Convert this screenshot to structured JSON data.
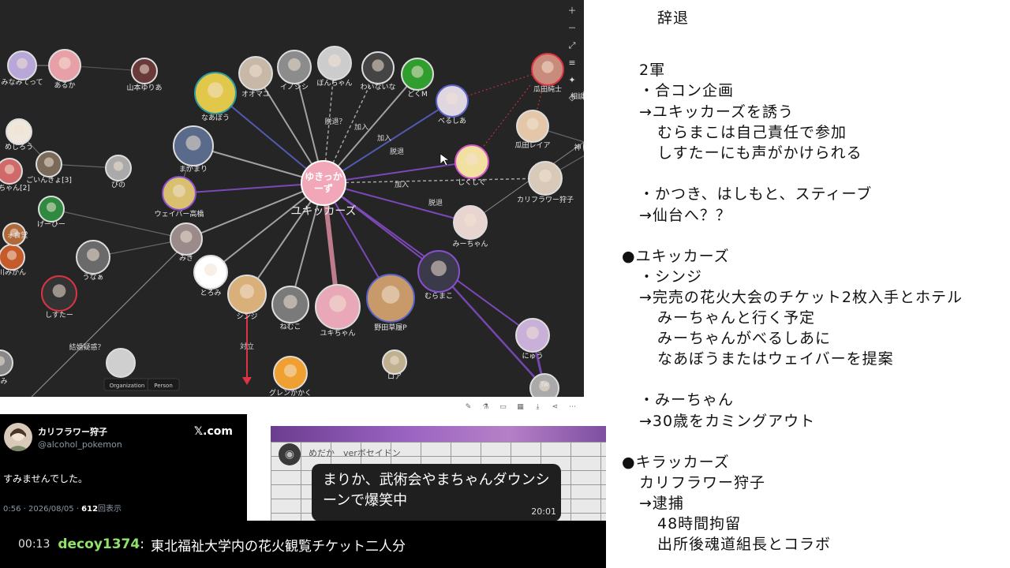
{
  "graph": {
    "hub": {
      "inner": "ゆきっか\nーず",
      "label": "ユキッカーズ"
    },
    "nodes": [
      {
        "label": "みなみてって",
        "color": "#b9a7d9",
        "ring": "#dddddd"
      },
      {
        "label": "あるか",
        "color": "#e8a0a8",
        "ring": "#dddddd"
      },
      {
        "label": "山本ゆりあ",
        "color": "#6a3a3a",
        "ring": "#dddddd"
      },
      {
        "label": "オオマユ",
        "color": "#c8b8a8",
        "ring": "#dddddd"
      },
      {
        "label": "イノシシ",
        "color": "#8c8c8c",
        "ring": "#dddddd"
      },
      {
        "label": "ぼんちゃん",
        "color": "#cccccc",
        "ring": "#dddddd"
      },
      {
        "label": "わいないな",
        "color": "#444444",
        "ring": "#dddddd"
      },
      {
        "label": "どくM",
        "color": "#2f9e2f",
        "ring": "#dddddd"
      },
      {
        "label": "なあぼう",
        "color": "#e2c84a",
        "ring": "#2f9aa0"
      },
      {
        "label": "べるしあ",
        "color": "#e0d6e0",
        "ring": "#5a63c9"
      },
      {
        "label": "瓜田純士",
        "color": "#c98c7c",
        "ring": "#dd3344"
      },
      {
        "label": "瓜田レイア",
        "color": "#e3c7a8",
        "ring": "#dddddd"
      },
      {
        "label": "めじろう",
        "color": "#efe6dc",
        "ring": "#dddddd"
      },
      {
        "label": "ごいんきょ[3]",
        "color": "#7a6a5a",
        "ring": "#dddddd"
      },
      {
        "label": "ぴの",
        "color": "#aaaaaa",
        "ring": "#dddddd"
      },
      {
        "label": "まがまり",
        "color": "#5a6a8a",
        "ring": "#dddddd"
      },
      {
        "label": "しくしぐ",
        "color": "#f2e0a0",
        "ring": "#d356c9"
      },
      {
        "label": "カリフラワー狩子",
        "color": "#d9c9b8",
        "ring": "#dddddd"
      },
      {
        "label": "げーひー",
        "color": "#2f8a3f",
        "ring": "#dddddd"
      },
      {
        "label": "ウェイバー高橋",
        "color": "#d8c070",
        "ring": "#8a4fd1"
      },
      {
        "label": "みーちゃん",
        "color": "#e9d5cf",
        "ring": "#dddddd"
      },
      {
        "label": "みき",
        "color": "#9a8a8a",
        "ring": "#dddddd"
      },
      {
        "label": "うなぁ",
        "color": "#6a6a6a",
        "ring": "#dddddd"
      },
      {
        "label": "むらまこ",
        "color": "#3a3a4a",
        "ring": "#8a4fd1"
      },
      {
        "label": "川みかん",
        "color": "#c55a2a",
        "ring": "#dddddd"
      },
      {
        "label": "しすたー",
        "color": "#333333",
        "ring": "#dd3344"
      },
      {
        "label": "とろみ",
        "color": "#ffffff",
        "ring": "#dddddd"
      },
      {
        "label": "シンジ",
        "color": "#d9b07a",
        "ring": "#dddddd"
      },
      {
        "label": "ねむこ",
        "color": "#7a7a7a",
        "ring": "#dddddd"
      },
      {
        "label": "ユキちゃん",
        "color": "#e8a8b8",
        "ring": "#dddddd"
      },
      {
        "label": "野田草履P",
        "color": "#c89a6a",
        "ring": "#5a63c9"
      },
      {
        "label": "にゅう",
        "color": "#c8b0d9",
        "ring": "#dddddd"
      },
      {
        "label": "グレンかかく",
        "color": "#f0a030",
        "ring": "#dddddd"
      },
      {
        "label": "ロア",
        "color": "#c0b090",
        "ring": "#dddddd"
      },
      {
        "label": "Tw",
        "color": "#aaaaaa",
        "ring": "#dddddd"
      },
      {
        "label": "神",
        "color": "#cccccc",
        "ring": "#dddddd"
      },
      {
        "label": "相談",
        "color": "#cccccc",
        "ring": "#dddddd"
      },
      {
        "label": "ォ食堂",
        "color": "#b06a3a",
        "ring": "#dddddd"
      },
      {
        "label": "ちゃん[2]",
        "color": "#d06a6a",
        "ring": "#dddddd"
      },
      {
        "label": "み",
        "color": "#888888",
        "ring": "#dddddd"
      }
    ],
    "edge_labels": [
      "脱退？",
      "加入",
      "加入",
      "脱退",
      "加入",
      "脱退",
      "対立",
      "結婚疑惑？"
    ],
    "legend": [
      "Organization",
      "Person"
    ]
  },
  "notes": {
    "lines": [
      "辞退",
      "",
      "2軍",
      "・合コン企画",
      "→ユキッカーズを誘う",
      "むらまこは自己責任で参加",
      "しすたーにも声がかけられる",
      "",
      "・かつき、はしもと、スティーブ",
      "→仙台へ？？",
      "",
      "●ユキッカーズ",
      "・シンジ",
      "→完売の花火大会のチケット2枚入手とホテル",
      "みーちゃんと行く予定",
      "みーちゃんがべるしあに",
      "なあぼうまたはウェイバーを提案",
      "",
      "・みーちゃん",
      "→30歳をカミングアウト",
      "",
      "●キラッカーズ",
      "カリフラワー狩子",
      "→逮捕",
      "48時間拘留",
      "出所後魂道組長とコラボ"
    ]
  },
  "tweet": {
    "name": "カリフラワー狩子",
    "handle": "@alcohol_pokemon",
    "brand": "𝕏.com",
    "body": "すみませんでした。",
    "meta_prefix": "0:56 · 2026/08/05 · ",
    "views": "612",
    "views_suffix": "回表示"
  },
  "video": {
    "user": "めだか　verボセイドン",
    "chat_text": "まりか、武術会やまちゃんダウンシーンで爆笑中",
    "chat_time": "20:01"
  },
  "subtitle": {
    "time": "00:13",
    "user": "decoy1374",
    "sep": ":",
    "message": "東北福祉大学内の花火観覧チケット二人分"
  },
  "colors": {
    "graph_bg": "#252525",
    "hub": "#f1a7b8",
    "edge_default": "#b8b8b8",
    "edge_purple": "#8a4fd1",
    "edge_red": "#dd3344",
    "username_green": "#8fe36a"
  }
}
